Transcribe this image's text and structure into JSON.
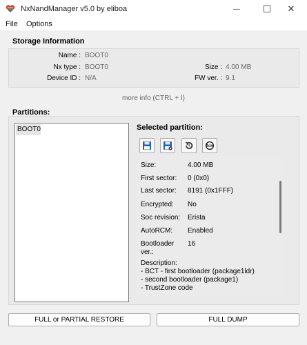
{
  "window": {
    "title": "NxNandManager v5.0 by eliboa",
    "icons": {
      "app": "heart-app-icon",
      "minimize": "minimize-icon",
      "maximize": "maximize-icon",
      "close": "close-icon"
    },
    "minimize_glyph": "—",
    "maximize_glyph": "☐",
    "close_glyph": "✕"
  },
  "menu": {
    "items": [
      "File",
      "Options"
    ]
  },
  "storage": {
    "title": "Storage Information",
    "name_label": "Name :",
    "name_value": "BOOT0",
    "type_label": "Nx type :",
    "type_value": "BOOT0",
    "device_label": "Device ID :",
    "device_value": "N/A",
    "size_label": "Size :",
    "size_value": "4.00 MB",
    "fw_label": "FW ver. :",
    "fw_value": "9.1"
  },
  "more_info": "more info (CTRL + I)",
  "partitions": {
    "title": "Partitions:",
    "items": [
      "BOOT0"
    ]
  },
  "selected": {
    "title": "Selected partition:",
    "toolbar_icons": [
      "save-floppy-icon",
      "save-floppy-settings-icon",
      "restore-icon",
      "rcm-icon"
    ],
    "size_label": "Size:",
    "size_value": "4.00 MB",
    "first_sector_label": "First sector:",
    "first_sector_value": "0 (0x0)",
    "last_sector_label": "Last sector:",
    "last_sector_value": "8191 (0x1FFF)",
    "encrypted_label": "Encrypted:",
    "encrypted_value": "No",
    "soc_label": "Soc revision:",
    "soc_value": "Erista",
    "autorcm_label": "AutoRCM:",
    "autorcm_value": "Enabled",
    "bootloader_label_1": "Bootloader",
    "bootloader_label_2": "ver.:",
    "bootloader_value": "16",
    "description_label": "Description:",
    "description_lines": [
      "- BCT - first bootloader (package1ldr)",
      "- second bootloader (package1)",
      "- TrustZone code"
    ]
  },
  "buttons": {
    "restore": "FULL or PARTIAL RESTORE",
    "dump": "FULL DUMP"
  },
  "colors": {
    "accent": "#1f5fbf",
    "heart_red": "#e03a3a"
  }
}
